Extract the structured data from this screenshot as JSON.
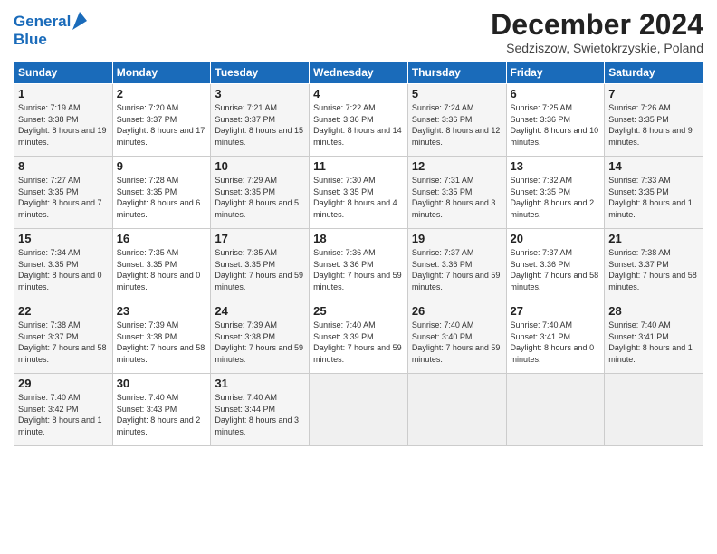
{
  "header": {
    "logo_line1": "General",
    "logo_line2": "Blue",
    "month_title": "December 2024",
    "subtitle": "Sedziszow, Swietokrzyskie, Poland"
  },
  "days_of_week": [
    "Sunday",
    "Monday",
    "Tuesday",
    "Wednesday",
    "Thursday",
    "Friday",
    "Saturday"
  ],
  "weeks": [
    [
      {
        "day": "1",
        "sunrise": "Sunrise: 7:19 AM",
        "sunset": "Sunset: 3:38 PM",
        "daylight": "Daylight: 8 hours and 19 minutes."
      },
      {
        "day": "2",
        "sunrise": "Sunrise: 7:20 AM",
        "sunset": "Sunset: 3:37 PM",
        "daylight": "Daylight: 8 hours and 17 minutes."
      },
      {
        "day": "3",
        "sunrise": "Sunrise: 7:21 AM",
        "sunset": "Sunset: 3:37 PM",
        "daylight": "Daylight: 8 hours and 15 minutes."
      },
      {
        "day": "4",
        "sunrise": "Sunrise: 7:22 AM",
        "sunset": "Sunset: 3:36 PM",
        "daylight": "Daylight: 8 hours and 14 minutes."
      },
      {
        "day": "5",
        "sunrise": "Sunrise: 7:24 AM",
        "sunset": "Sunset: 3:36 PM",
        "daylight": "Daylight: 8 hours and 12 minutes."
      },
      {
        "day": "6",
        "sunrise": "Sunrise: 7:25 AM",
        "sunset": "Sunset: 3:36 PM",
        "daylight": "Daylight: 8 hours and 10 minutes."
      },
      {
        "day": "7",
        "sunrise": "Sunrise: 7:26 AM",
        "sunset": "Sunset: 3:35 PM",
        "daylight": "Daylight: 8 hours and 9 minutes."
      }
    ],
    [
      {
        "day": "8",
        "sunrise": "Sunrise: 7:27 AM",
        "sunset": "Sunset: 3:35 PM",
        "daylight": "Daylight: 8 hours and 7 minutes."
      },
      {
        "day": "9",
        "sunrise": "Sunrise: 7:28 AM",
        "sunset": "Sunset: 3:35 PM",
        "daylight": "Daylight: 8 hours and 6 minutes."
      },
      {
        "day": "10",
        "sunrise": "Sunrise: 7:29 AM",
        "sunset": "Sunset: 3:35 PM",
        "daylight": "Daylight: 8 hours and 5 minutes."
      },
      {
        "day": "11",
        "sunrise": "Sunrise: 7:30 AM",
        "sunset": "Sunset: 3:35 PM",
        "daylight": "Daylight: 8 hours and 4 minutes."
      },
      {
        "day": "12",
        "sunrise": "Sunrise: 7:31 AM",
        "sunset": "Sunset: 3:35 PM",
        "daylight": "Daylight: 8 hours and 3 minutes."
      },
      {
        "day": "13",
        "sunrise": "Sunrise: 7:32 AM",
        "sunset": "Sunset: 3:35 PM",
        "daylight": "Daylight: 8 hours and 2 minutes."
      },
      {
        "day": "14",
        "sunrise": "Sunrise: 7:33 AM",
        "sunset": "Sunset: 3:35 PM",
        "daylight": "Daylight: 8 hours and 1 minute."
      }
    ],
    [
      {
        "day": "15",
        "sunrise": "Sunrise: 7:34 AM",
        "sunset": "Sunset: 3:35 PM",
        "daylight": "Daylight: 8 hours and 0 minutes."
      },
      {
        "day": "16",
        "sunrise": "Sunrise: 7:35 AM",
        "sunset": "Sunset: 3:35 PM",
        "daylight": "Daylight: 8 hours and 0 minutes."
      },
      {
        "day": "17",
        "sunrise": "Sunrise: 7:35 AM",
        "sunset": "Sunset: 3:35 PM",
        "daylight": "Daylight: 7 hours and 59 minutes."
      },
      {
        "day": "18",
        "sunrise": "Sunrise: 7:36 AM",
        "sunset": "Sunset: 3:36 PM",
        "daylight": "Daylight: 7 hours and 59 minutes."
      },
      {
        "day": "19",
        "sunrise": "Sunrise: 7:37 AM",
        "sunset": "Sunset: 3:36 PM",
        "daylight": "Daylight: 7 hours and 59 minutes."
      },
      {
        "day": "20",
        "sunrise": "Sunrise: 7:37 AM",
        "sunset": "Sunset: 3:36 PM",
        "daylight": "Daylight: 7 hours and 58 minutes."
      },
      {
        "day": "21",
        "sunrise": "Sunrise: 7:38 AM",
        "sunset": "Sunset: 3:37 PM",
        "daylight": "Daylight: 7 hours and 58 minutes."
      }
    ],
    [
      {
        "day": "22",
        "sunrise": "Sunrise: 7:38 AM",
        "sunset": "Sunset: 3:37 PM",
        "daylight": "Daylight: 7 hours and 58 minutes."
      },
      {
        "day": "23",
        "sunrise": "Sunrise: 7:39 AM",
        "sunset": "Sunset: 3:38 PM",
        "daylight": "Daylight: 7 hours and 58 minutes."
      },
      {
        "day": "24",
        "sunrise": "Sunrise: 7:39 AM",
        "sunset": "Sunset: 3:38 PM",
        "daylight": "Daylight: 7 hours and 59 minutes."
      },
      {
        "day": "25",
        "sunrise": "Sunrise: 7:40 AM",
        "sunset": "Sunset: 3:39 PM",
        "daylight": "Daylight: 7 hours and 59 minutes."
      },
      {
        "day": "26",
        "sunrise": "Sunrise: 7:40 AM",
        "sunset": "Sunset: 3:40 PM",
        "daylight": "Daylight: 7 hours and 59 minutes."
      },
      {
        "day": "27",
        "sunrise": "Sunrise: 7:40 AM",
        "sunset": "Sunset: 3:41 PM",
        "daylight": "Daylight: 8 hours and 0 minutes."
      },
      {
        "day": "28",
        "sunrise": "Sunrise: 7:40 AM",
        "sunset": "Sunset: 3:41 PM",
        "daylight": "Daylight: 8 hours and 1 minute."
      }
    ],
    [
      {
        "day": "29",
        "sunrise": "Sunrise: 7:40 AM",
        "sunset": "Sunset: 3:42 PM",
        "daylight": "Daylight: 8 hours and 1 minute."
      },
      {
        "day": "30",
        "sunrise": "Sunrise: 7:40 AM",
        "sunset": "Sunset: 3:43 PM",
        "daylight": "Daylight: 8 hours and 2 minutes."
      },
      {
        "day": "31",
        "sunrise": "Sunrise: 7:40 AM",
        "sunset": "Sunset: 3:44 PM",
        "daylight": "Daylight: 8 hours and 3 minutes."
      },
      null,
      null,
      null,
      null
    ]
  ]
}
